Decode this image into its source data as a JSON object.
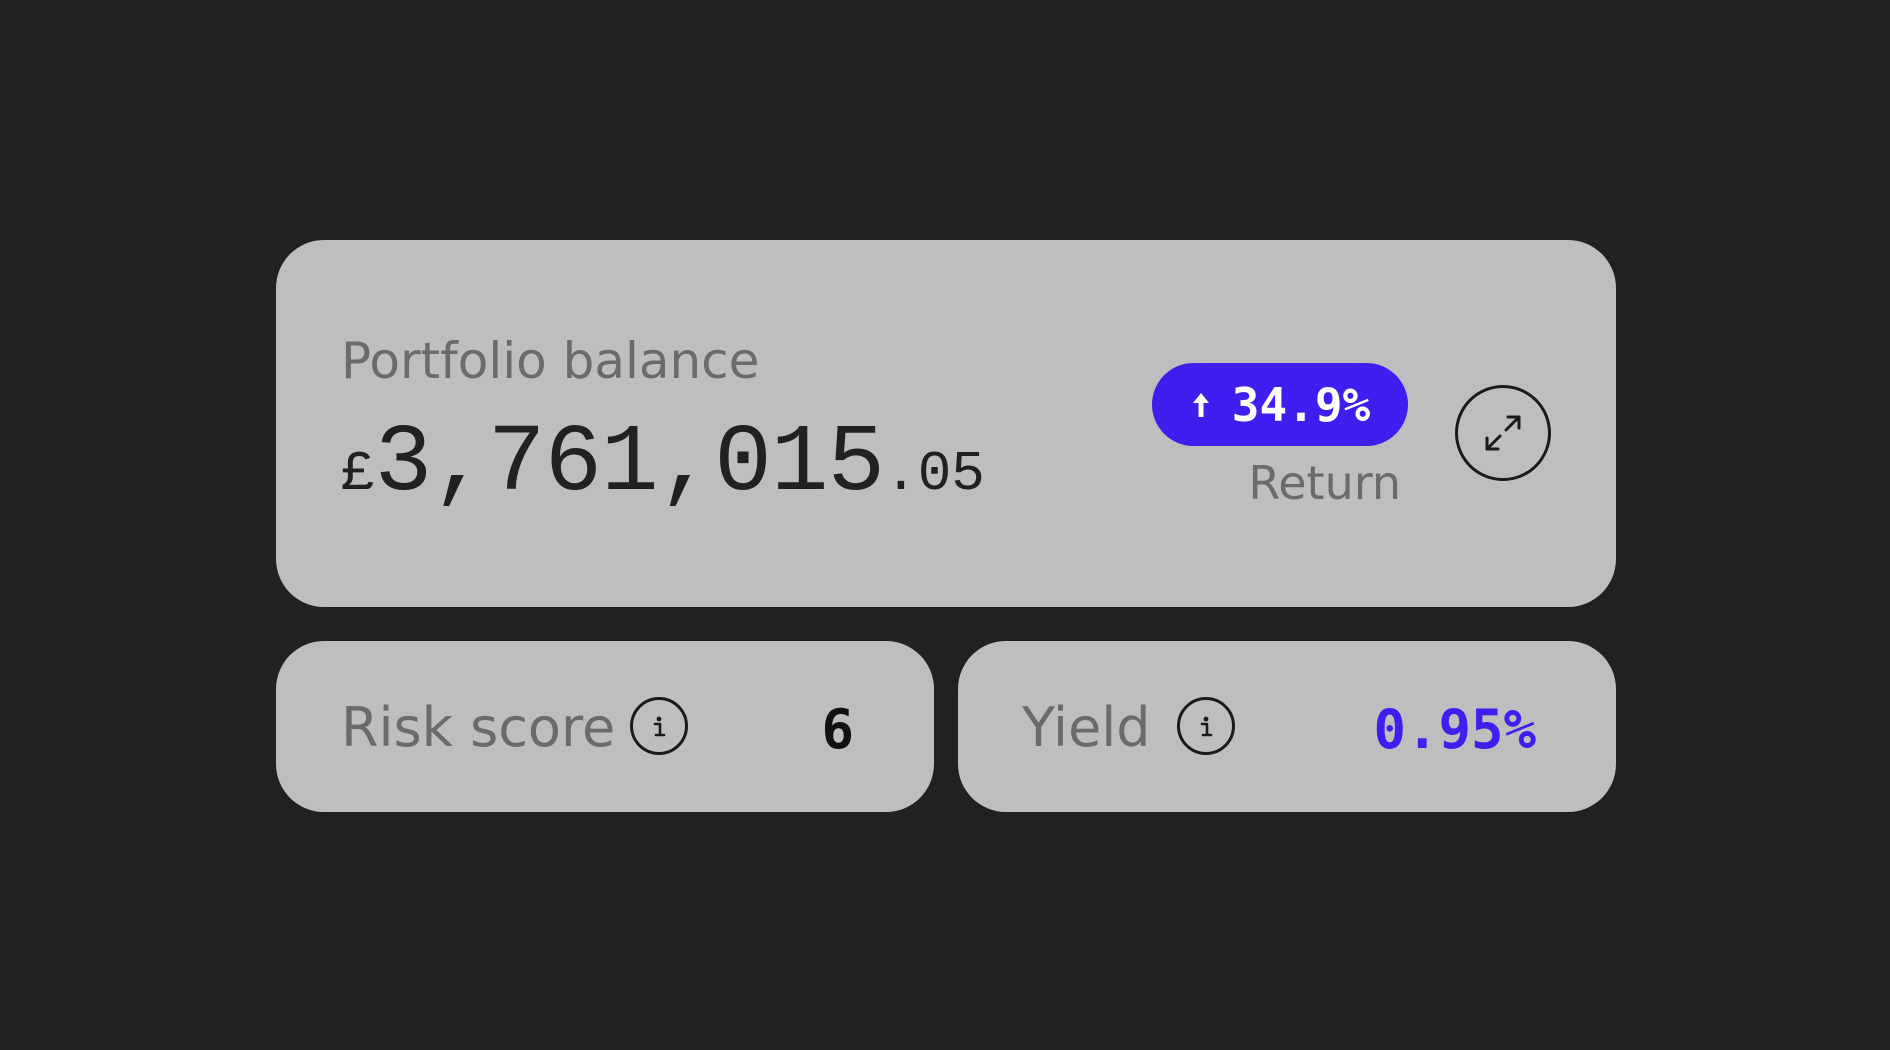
{
  "portfolio": {
    "label": "Portfolio balance",
    "currency_symbol": "£",
    "balance_integer": "3,761,015",
    "balance_decimal": ".05"
  },
  "return": {
    "value": "34.9%",
    "label": "Return",
    "direction_icon": "up-arrow-icon"
  },
  "expand": {
    "icon": "expand-icon"
  },
  "risk": {
    "label": "Risk score",
    "value": "6",
    "icon": "info-icon"
  },
  "yield": {
    "label": "Yield",
    "value": "0.95%",
    "icon": "info-icon"
  },
  "colors": {
    "background": "#212121",
    "card": "#bebebe",
    "accent": "#3f1ef0",
    "label": "#6b6b6b",
    "text": "#212121"
  }
}
